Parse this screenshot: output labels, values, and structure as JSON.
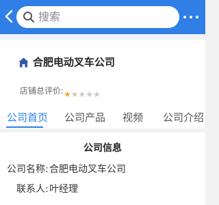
{
  "header": {
    "search_placeholder": "搜索",
    "colors": {
      "bar": "#2f7fe6"
    },
    "icons": [
      "back-arrow-icon",
      "search-icon",
      "more-icon"
    ]
  },
  "shop": {
    "name": "合肥电动叉车公司",
    "rating_label": "店铺总评价:",
    "rating_stars": 1,
    "rating_max": 5,
    "icon": "home-icon"
  },
  "tabs": [
    {
      "label": "公司首页",
      "active": true
    },
    {
      "label": "公司产品",
      "active": false
    },
    {
      "label": "视频",
      "active": false
    },
    {
      "label": "公司介绍",
      "active": false
    }
  ],
  "company_info": {
    "title": "公司信息",
    "rows": [
      {
        "label": "公司名称:",
        "value": "合肥电动叉车公司"
      },
      {
        "label": "联系人:",
        "value": "叶经理"
      }
    ]
  }
}
